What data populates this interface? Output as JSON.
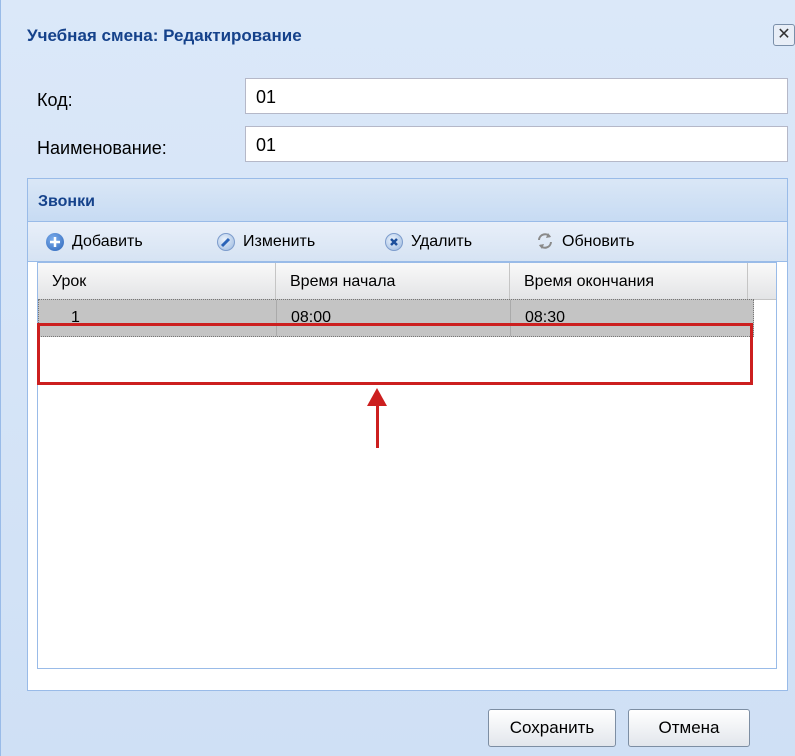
{
  "window": {
    "title": "Учебная смена: Редактирование",
    "close_glyph": "✕"
  },
  "fields": {
    "code_label": "Код:",
    "code_value": "01",
    "name_label": "Наименование:",
    "name_value": "01"
  },
  "panel": {
    "title": "Звонки",
    "toolbar": {
      "add": "Добавить",
      "edit": "Изменить",
      "delete": "Удалить",
      "refresh": "Обновить"
    },
    "columns": [
      "Урок",
      "Время начала",
      "Время окончания"
    ],
    "rows": [
      {
        "lesson": "1",
        "start": "08:00",
        "end": "08:30"
      }
    ]
  },
  "footer": {
    "save": "Сохранить",
    "cancel": "Отмена"
  },
  "colors": {
    "highlight": "#cc1f1f",
    "title": "#15428b",
    "selected_row": "#c4c4c4"
  }
}
